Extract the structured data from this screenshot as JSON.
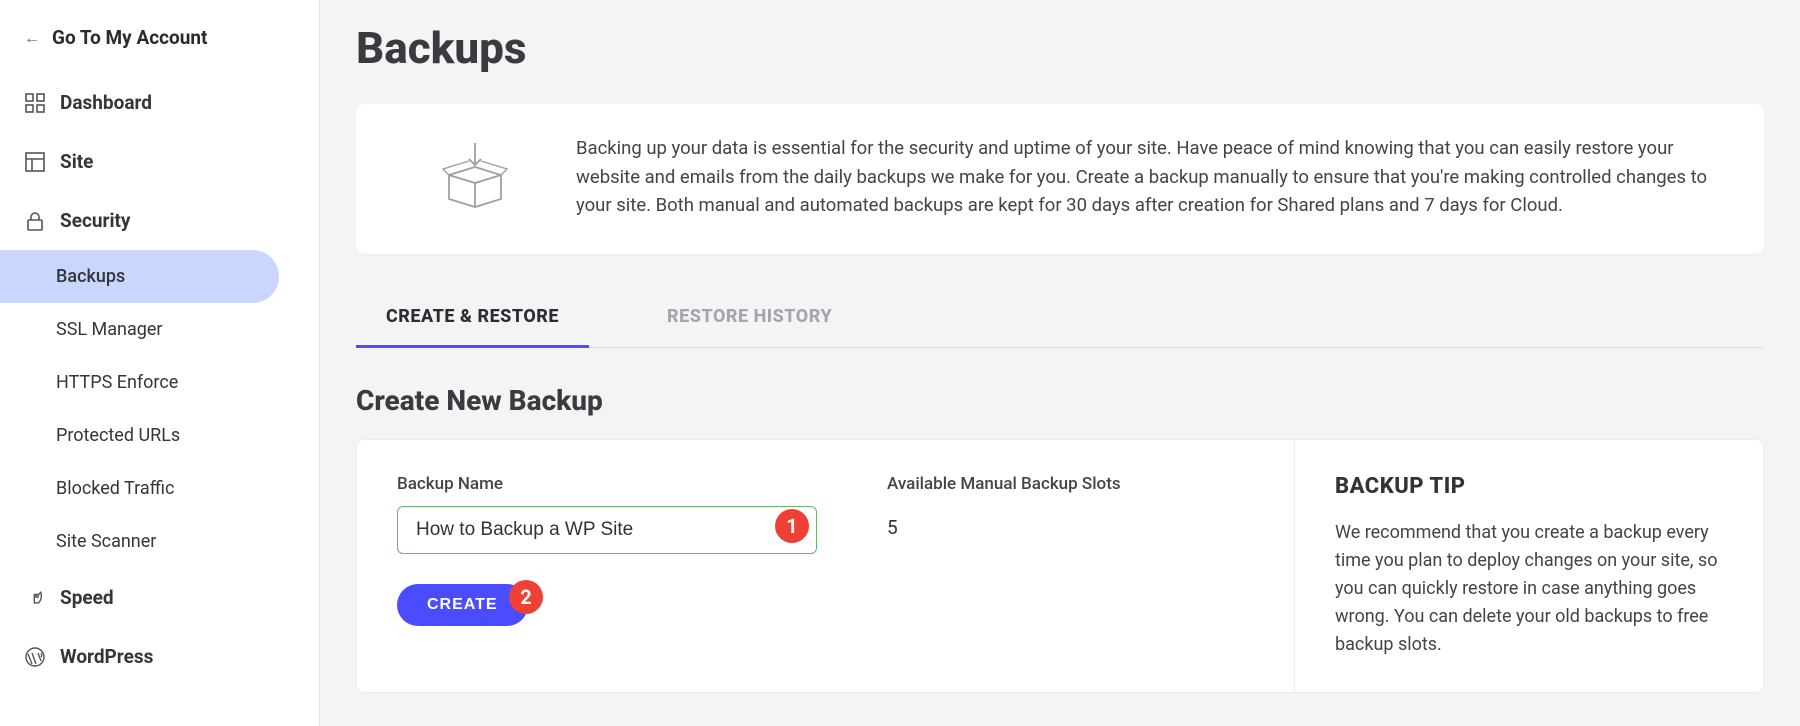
{
  "sidebar": {
    "go_back": "Go To My Account",
    "items": [
      {
        "label": "Dashboard"
      },
      {
        "label": "Site"
      },
      {
        "label": "Security"
      },
      {
        "label": "Speed"
      },
      {
        "label": "WordPress"
      }
    ],
    "security_sub": [
      {
        "label": "Backups"
      },
      {
        "label": "SSL Manager"
      },
      {
        "label": "HTTPS Enforce"
      },
      {
        "label": "Protected URLs"
      },
      {
        "label": "Blocked Traffic"
      },
      {
        "label": "Site Scanner"
      }
    ]
  },
  "page": {
    "title": "Backups"
  },
  "info": {
    "text": "Backing up your data is essential for the security and uptime of your site. Have peace of mind knowing that you can easily restore your website and emails from the daily backups we make for you. Create a backup manually to ensure that you're making controlled changes to your site. Both manual and automated backups are kept for 30 days after creation for Shared plans and 7 days for Cloud."
  },
  "tabs": {
    "create": "Create & Restore",
    "history": "Restore History"
  },
  "form": {
    "section_title": "Create New Backup",
    "name_label": "Backup Name",
    "name_value": "How to Backup a WP Site",
    "slots_label": "Available Manual Backup Slots",
    "slots_value": "5",
    "create_button": "CREATE"
  },
  "tip": {
    "title": "BACKUP TIP",
    "text": "We recommend that you create a backup every time you plan to deploy changes on your site, so you can quickly restore in case anything goes wrong. You can delete your old backups to free backup slots."
  },
  "annotations": {
    "one": "1",
    "two": "2"
  }
}
